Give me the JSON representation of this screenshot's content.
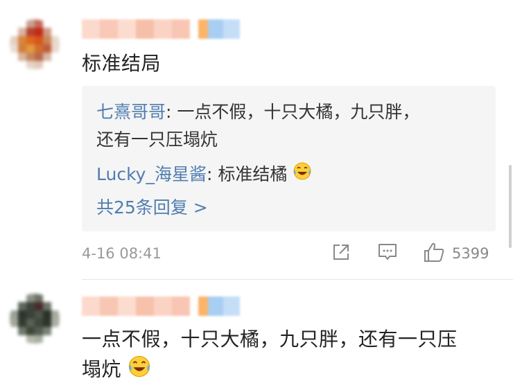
{
  "comments": [
    {
      "text": "标准结局",
      "replies": [
        {
          "name": "七熹哥哥",
          "sep": ": ",
          "text": "一点不假，十只大橘，九只胖，",
          "text_cont": "还有一只压塌炕"
        },
        {
          "name": "Lucky_海星酱",
          "sep": ": ",
          "text": "标准结橘"
        }
      ],
      "more_replies": "共25条回复 >",
      "timestamp": "4-16 08:41",
      "like_count": "5399"
    },
    {
      "text_line1": "一点不假，十只大橘，九只胖，还有一只压",
      "text_line2": "塌炕"
    }
  ],
  "icons": {
    "share": "share-icon",
    "comment": "comment-icon",
    "like": "thumbs-up-icon",
    "emoji": "laughing-crying-emoji-icon"
  },
  "colors": {
    "link": "#507daf",
    "text": "#222222",
    "meta": "#999999",
    "reply_bg": "#f5f5f5"
  }
}
